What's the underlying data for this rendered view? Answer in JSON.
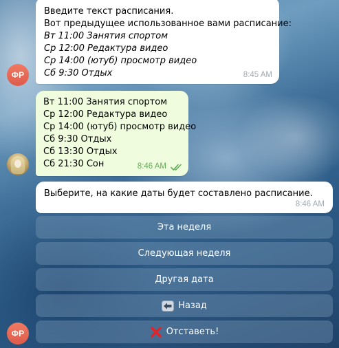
{
  "messages": {
    "bot_prompt": {
      "avatar_initials": "ФР",
      "lines": [
        "Введите текст расписания.",
        "Вот предыдущее использованное вами расписание:"
      ],
      "italic_lines": [
        "Вт 11:00 Занятия спортом",
        "Ср 12:00 Редактура видео",
        "Ср 14:00 (ютуб) просмотр видео",
        "Сб 9:30 Отдых"
      ],
      "time": "8:45 AM"
    },
    "user_schedule": {
      "lines": [
        "Вт 11:00 Занятия спортом",
        "Ср 12:00 Редактура видео",
        "Ср 14:00 (ютуб) просмотр видео",
        "Сб 9:30 Отдых",
        "Сб 13:30 Отдых",
        "Сб 21:30 Сон"
      ],
      "time": "8:46 AM",
      "status": "read"
    },
    "bot_question": {
      "avatar_initials": "ФР",
      "text": "Выберите, на какие даты будет составлено расписание.",
      "time": "8:46 AM"
    }
  },
  "keyboard": {
    "buttons": [
      {
        "label": "Эта неделя"
      },
      {
        "label": "Следующая неделя"
      },
      {
        "label": "Другая дата"
      },
      {
        "label": "Назад",
        "icon": "back-arrow-icon"
      },
      {
        "label": "Отставеть!",
        "icon": "red-cross-icon"
      }
    ]
  },
  "colors": {
    "bubble_in": "#ffffff",
    "bubble_out": "#effdde",
    "avatar_bot": "#e4604e",
    "read_ticks": "#62ac55",
    "cross": "#e0242a"
  }
}
